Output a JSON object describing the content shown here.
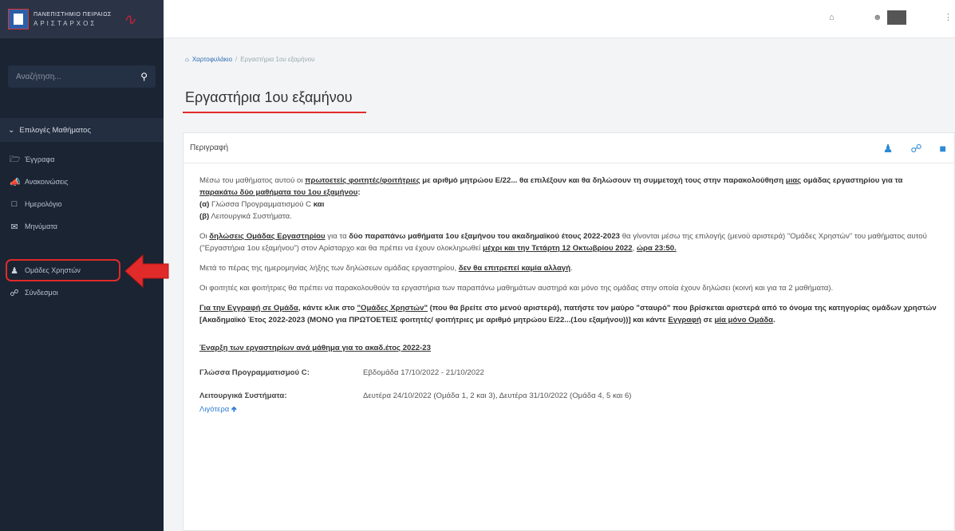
{
  "colors": {
    "sidebar": "#1a2433",
    "accent_red": "#e12a2a",
    "link_blue": "#2f6db3"
  },
  "logo": {
    "line1": "ΠΑΝΕΠΙΣΤΗΜΙΟ ΠΕΙΡΑΙΩΣ",
    "line2": "ΑΡΙΣΤΑΡΧΟΣ"
  },
  "sidebar": {
    "search_placeholder": "Αναζήτηση...",
    "course_menu_label": "Επιλογές Μαθήματος",
    "items": [
      {
        "label": "Έγγραφα",
        "icon": "folder-open-icon"
      },
      {
        "label": "Ανακοινώσεις",
        "icon": "bullhorn-icon"
      },
      {
        "label": "Ημερολόγιο",
        "icon": "calendar-icon"
      },
      {
        "label": "Μηνύματα",
        "icon": "envelope-icon"
      },
      {
        "label": "Ομάδες Χρηστών",
        "icon": "users-icon"
      },
      {
        "label": "Σύνδεσμοι",
        "icon": "link-icon"
      }
    ]
  },
  "breadcrumb": {
    "home": "Χαρτοφυλάκιο",
    "current": "Εργαστήρια 1ου εξαμήνου"
  },
  "page_title": "Εργαστήρια 1ου εξαμήνου",
  "panel": {
    "title": "Περιγραφή",
    "p1": {
      "t1": "Μέσω του μαθήματος αυτού οι ",
      "b1": "πρωτοετείς φοιτητές/φοιτήτριες",
      "t2": " με αριθμό μητρώου Ε/22... θα επιλέξουν και θα δηλώσουν τη συμμετοχή τους στην παρακολούθηση ",
      "b2": "μιας",
      "t3": " ομάδας εργαστηρίου για τα ",
      "b3": "παρακάτω δύο μαθήματα",
      "b4": " του 1ου εξαμήνου",
      "t4": ":",
      "a_label": "(α)",
      "a_text": " Γλώσσα Προγραμματισμού C ",
      "a_and": "και",
      "b_label": "(β)",
      "b_text": " Λειτουργικά Συστήματα."
    },
    "p2": {
      "t1": "Οι ",
      "b1": "δηλώσεις Ομάδας Εργαστηρίου",
      "t2": " για τα ",
      "b2": "δύο παραπάνω μαθήματα 1ου εξαμήνου του ακαδημαϊκού έτους 2022-2023",
      "t3": " θα γίνονται μέσω της επιλογής (μενού αριστερά) \"Ομάδες Χρηστών\" του μαθήματος αυτού (\"Εργαστήρια 1ου εξαμήνου\") στον Αρίσταρχο και θα πρέπει να έχουν ολοκληρωθεί ",
      "b3": "μέχρι και την Τετάρτη 12 Οκτωβρίου 2022",
      "t4": ", ",
      "b4": "ώρα 23:50."
    },
    "p3": {
      "t1": "Μετά το πέρας της ημερομηνίας λήξης των δηλώσεων ομάδας εργαστηρίου, ",
      "b1": "δεν θα επιτρεπεί καμία αλλαγή",
      "t2": "."
    },
    "p4": "Οι φοιτητές και φοιτήτριες θα πρέπει να παρακολουθούν τα εργαστήρια των παραπάνω μαθημάτων αυστηρά και μόνο της ομάδας στην οποία έχουν δηλώσει (κοινή και για τα 2 μαθήματα).",
    "p5": {
      "b1": "Για την Εγγραφή σε Ομάδα",
      "t1": ", κάντε κλικ στο ",
      "b2": "\"Ομάδες Χρηστών\"",
      "t2": " (που θα βρείτε στο μενού αριστερά), πατήστε τον μαύρο \"σταυρό\" που βρίσκεται αριστερά από το όνομα της κατηγορίας ομάδων χρηστών [Ακαδημαϊκό Έτος 2022-2023 (ΜΟΝΟ για ΠΡΩΤΟΕΤΕΙΣ φοιτητές/ φοιτήτριες με αριθμό μητρώου Ε/22...(1ου εξαμήνου))] και κάντε ",
      "b3": "Εγγραφή",
      "t3": " σε ",
      "b4": "μία μόνο Ομάδα",
      "t4": "."
    },
    "start_heading": "Έναρξη των εργαστηρίων ανά μάθημα για το ακαδ.έτος 2022-23",
    "starts": [
      {
        "course": "Γλώσσα Προγραμματισμού C:",
        "dates": "Εβδομάδα 17/10/2022 - 21/10/2022"
      },
      {
        "course": "Λειτουργικά Συστήματα:",
        "dates": "Δευτέρα 24/10/2022 (Ομάδα 1, 2 και 3), Δευτέρα 31/10/2022 (Ομάδα 4, 5 και 6)"
      }
    ],
    "less_label": "Λιγότερα"
  }
}
